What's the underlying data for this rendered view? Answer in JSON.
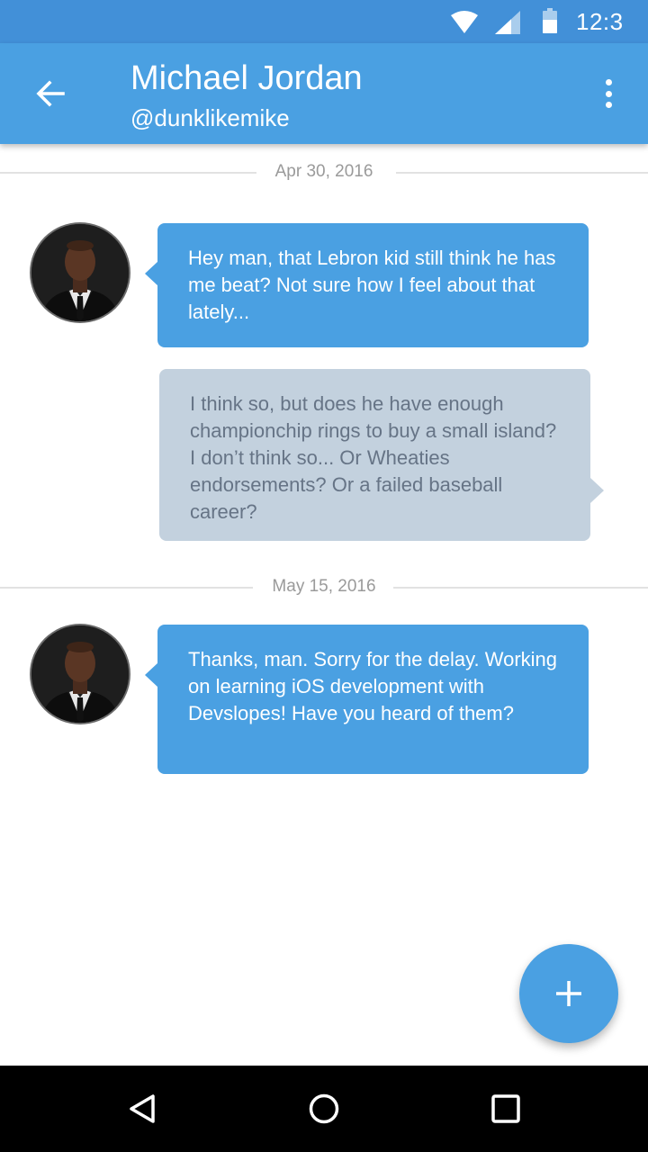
{
  "status_bar": {
    "time": "12:3",
    "icons": [
      "wifi-icon",
      "signal-icon",
      "battery-icon"
    ]
  },
  "app_bar": {
    "title": "Michael Jordan",
    "subtitle": "@dunklikemike",
    "icons": [
      "back-arrow-icon",
      "more-vert-icon"
    ]
  },
  "conversation": [
    {
      "date": "Apr 30, 2016"
    },
    {
      "from": "them",
      "text": "Hey man, that Lebron kid still think he has me beat? Not sure how I feel about that lately..."
    },
    {
      "from": "me",
      "text": "I think so, but does he have enough championchip rings to buy a small island? I don’t think so... Or Wheaties endorsements? Or a failed baseball career?"
    },
    {
      "date": "May 15, 2016"
    },
    {
      "from": "them",
      "text": "Thanks, man. Sorry for the delay. Working on learning iOS development with Devslopes! Have you heard of them?"
    }
  ],
  "fab": {
    "icon": "plus-icon"
  },
  "nav_bar": {
    "icons": [
      "back-triangle-icon",
      "home-circle-icon",
      "recents-square-icon"
    ]
  },
  "colors": {
    "status_bar": "#4290d8",
    "app_bar": "#4aa0e2",
    "incoming_bubble": "#4aa0e2",
    "outgoing_bubble": "#c3d1de",
    "outgoing_text": "#667486",
    "date_text": "#9a9a9a"
  }
}
